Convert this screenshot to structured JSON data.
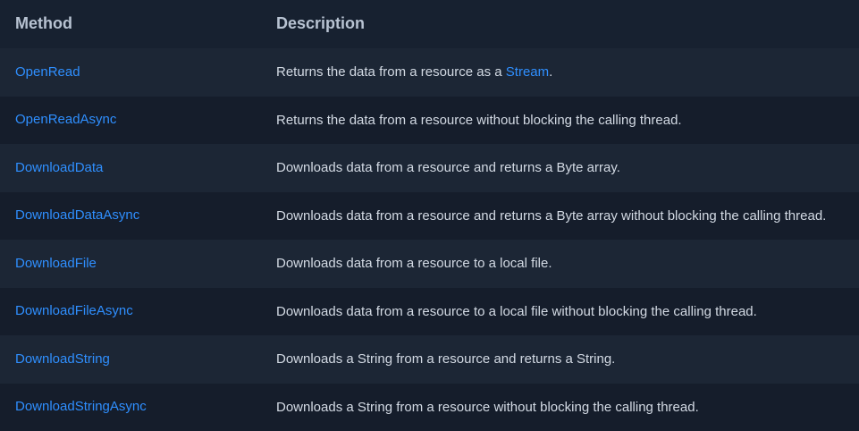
{
  "table": {
    "headers": {
      "method": "Method",
      "description": "Description"
    },
    "rows": [
      {
        "method": "OpenRead",
        "desc_before": "Returns the data from a resource as a ",
        "desc_link": "Stream",
        "desc_after": "."
      },
      {
        "method": "OpenReadAsync",
        "desc_before": "Returns the data from a resource without blocking the calling thread.",
        "desc_link": "",
        "desc_after": ""
      },
      {
        "method": "DownloadData",
        "desc_before": "Downloads data from a resource and returns a Byte array.",
        "desc_link": "",
        "desc_after": ""
      },
      {
        "method": "DownloadDataAsync",
        "desc_before": "Downloads data from a resource and returns a Byte array without blocking the calling thread.",
        "desc_link": "",
        "desc_after": ""
      },
      {
        "method": "DownloadFile",
        "desc_before": "Downloads data from a resource to a local file.",
        "desc_link": "",
        "desc_after": ""
      },
      {
        "method": "DownloadFileAsync",
        "desc_before": "Downloads data from a resource to a local file without blocking the calling thread.",
        "desc_link": "",
        "desc_after": ""
      },
      {
        "method": "DownloadString",
        "desc_before": "Downloads a String from a resource and returns a String.",
        "desc_link": "",
        "desc_after": ""
      },
      {
        "method": "DownloadStringAsync",
        "desc_before": "Downloads a String from a resource without blocking the calling thread.",
        "desc_link": "",
        "desc_after": ""
      }
    ]
  },
  "colors": {
    "background": "#141c29",
    "header_background": "#172130",
    "row_even": "#1c2635",
    "row_odd": "#151d2b",
    "header_text": "#b8c3d2",
    "link": "#2f8fff",
    "body_text": "#d3dae4"
  }
}
